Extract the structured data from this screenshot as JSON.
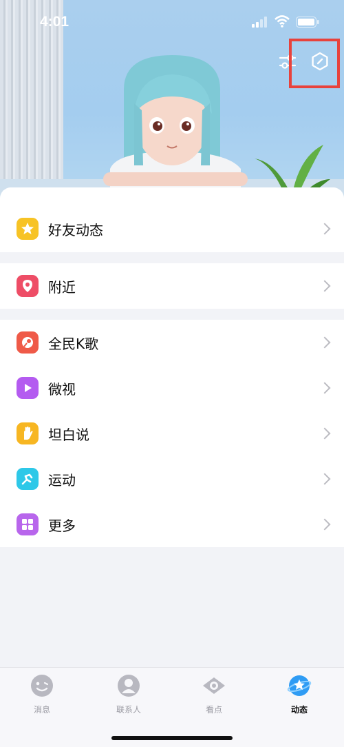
{
  "status_bar": {
    "time": "4:01"
  },
  "list": {
    "groups": [
      [
        {
          "label": "好友动态",
          "icon": "qzone-star-icon",
          "color": "#f7c325"
        }
      ],
      [
        {
          "label": "附近",
          "icon": "location-pin-icon",
          "color": "#ee4d66"
        }
      ],
      [
        {
          "label": "全民K歌",
          "icon": "karaoke-icon",
          "color": "#ef5a48"
        },
        {
          "label": "微视",
          "icon": "weishi-play-icon",
          "color": "#b45bf0"
        },
        {
          "label": "坦白说",
          "icon": "hand-icon",
          "color": "#f7b622"
        },
        {
          "label": "运动",
          "icon": "running-icon",
          "color": "#2ec8e8"
        },
        {
          "label": "更多",
          "icon": "grid-more-icon",
          "color": "#b866ec"
        }
      ]
    ]
  },
  "tabs": [
    {
      "label": "消息",
      "icon": "message-face-icon",
      "active": false
    },
    {
      "label": "联系人",
      "icon": "contact-person-icon",
      "active": false
    },
    {
      "label": "看点",
      "icon": "eye-icon",
      "active": false
    },
    {
      "label": "动态",
      "icon": "planet-star-icon",
      "active": true
    }
  ],
  "colors": {
    "highlight": "#e8423c",
    "active_tab": "#2f9cf4"
  }
}
